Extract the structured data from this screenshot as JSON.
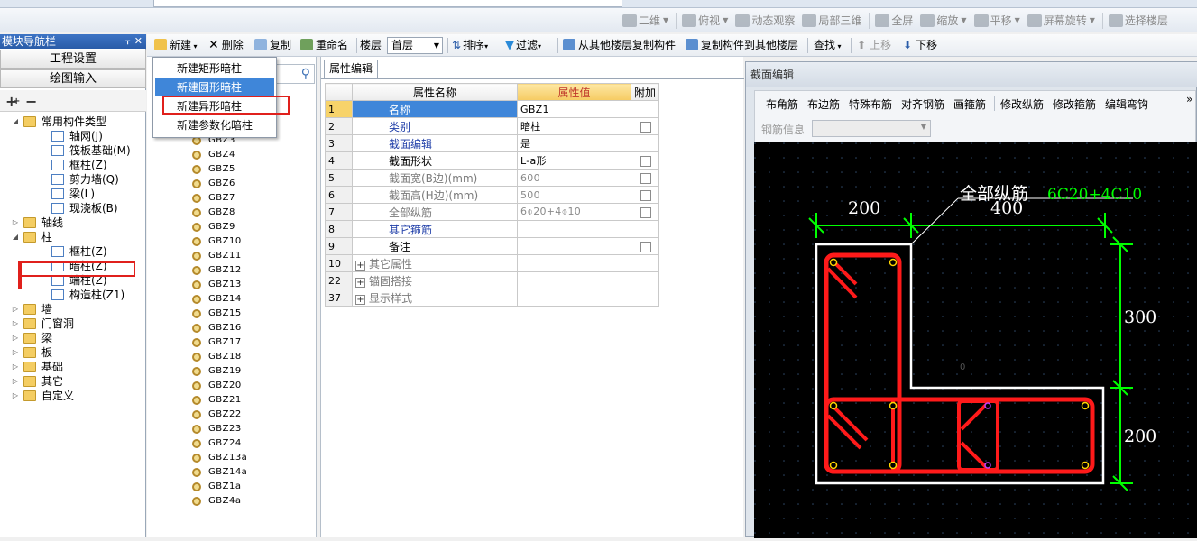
{
  "view_toolbar": {
    "items": [
      {
        "label": "二维",
        "caret": true
      },
      {
        "label": "俯视",
        "caret": true
      },
      {
        "label": "动态观察",
        "caret": false
      },
      {
        "label": "局部三维",
        "caret": false
      },
      {
        "label": "全屏",
        "caret": false
      },
      {
        "label": "缩放",
        "caret": true
      },
      {
        "label": "平移",
        "caret": true
      },
      {
        "label": "屏幕旋转",
        "caret": true
      },
      {
        "label": "选择楼层",
        "caret": false
      }
    ]
  },
  "nav": {
    "title": "模块导航栏",
    "pin": "ᚁ",
    "close": "✕",
    "project_settings": "工程设置",
    "drawing_input": "绘图输入",
    "tree": [
      {
        "level": 0,
        "expand": "◢",
        "label": "常用构件类型",
        "icon": "folder"
      },
      {
        "level": 1,
        "label": "轴网(J)",
        "icon": "comp"
      },
      {
        "level": 1,
        "label": "筏板基础(M)",
        "icon": "comp"
      },
      {
        "level": 1,
        "label": "框柱(Z)",
        "icon": "comp"
      },
      {
        "level": 1,
        "label": "剪力墙(Q)",
        "icon": "comp"
      },
      {
        "level": 1,
        "label": "梁(L)",
        "icon": "comp"
      },
      {
        "level": 1,
        "label": "现浇板(B)",
        "icon": "comp"
      },
      {
        "level": 0,
        "expand": "▷",
        "label": "轴线",
        "icon": "folder"
      },
      {
        "level": 0,
        "expand": "◢",
        "label": "柱",
        "icon": "folder"
      },
      {
        "level": 1,
        "label": "框柱(Z)",
        "icon": "comp"
      },
      {
        "level": 1,
        "label": "暗柱(Z)",
        "icon": "comp"
      },
      {
        "level": 1,
        "label": "端柱(Z)",
        "icon": "comp"
      },
      {
        "level": 1,
        "label": "构造柱(Z1)",
        "icon": "comp"
      },
      {
        "level": 0,
        "expand": "▷",
        "label": "墙",
        "icon": "folder"
      },
      {
        "level": 0,
        "expand": "▷",
        "label": "门窗洞",
        "icon": "folder"
      },
      {
        "level": 0,
        "expand": "▷",
        "label": "梁",
        "icon": "folder"
      },
      {
        "level": 0,
        "expand": "▷",
        "label": "板",
        "icon": "folder"
      },
      {
        "level": 0,
        "expand": "▷",
        "label": "基础",
        "icon": "folder"
      },
      {
        "level": 0,
        "expand": "▷",
        "label": "其它",
        "icon": "folder"
      },
      {
        "level": 0,
        "expand": "▷",
        "label": "自定义",
        "icon": "folder"
      }
    ]
  },
  "main_toolbar": {
    "new": "新建",
    "delete": "删除",
    "copy": "复制",
    "rename": "重命名",
    "floor_label": "楼层",
    "floor_value": "首层",
    "sort": "排序",
    "filter": "过滤",
    "copy_from_floor": "从其他楼层复制构件",
    "copy_to_floor": "复制构件到其他楼层",
    "find": "查找",
    "move_up": "上移",
    "move_down": "下移"
  },
  "new_menu": [
    {
      "label": "新建矩形暗柱",
      "active": false
    },
    {
      "label": "新建圆形暗柱",
      "active": true
    },
    {
      "label": "新建异形暗柱",
      "active": false
    },
    {
      "label": "新建参数化暗柱",
      "active": false
    }
  ],
  "component_list": [
    "GBZ3",
    "GBZ4",
    "GBZ5",
    "GBZ6",
    "GBZ7",
    "GBZ8",
    "GBZ9",
    "GBZ10",
    "GBZ11",
    "GBZ12",
    "GBZ13",
    "GBZ14",
    "GBZ15",
    "GBZ16",
    "GBZ17",
    "GBZ18",
    "GBZ19",
    "GBZ20",
    "GBZ21",
    "GBZ22",
    "GBZ23",
    "GBZ24",
    "GBZ13a",
    "GBZ14a",
    "GBZ1a",
    "GBZ4a"
  ],
  "properties": {
    "tab": "属性编辑",
    "headers": {
      "name": "属性名称",
      "value": "属性值",
      "extra": "附加"
    },
    "rows": [
      {
        "num": "1",
        "name": "名称",
        "value": "GBZ1",
        "style": "sel",
        "check": false
      },
      {
        "num": "2",
        "name": "类别",
        "value": "暗柱",
        "style": "blue",
        "check": true
      },
      {
        "num": "3",
        "name": "截面编辑",
        "value": "是",
        "style": "blue",
        "check": false
      },
      {
        "num": "4",
        "name": "截面形状",
        "value": "L-a形",
        "style": "normal",
        "check": true
      },
      {
        "num": "5",
        "name": "截面宽(B边)(mm)",
        "value": "600",
        "style": "gray",
        "check": true
      },
      {
        "num": "6",
        "name": "截面高(H边)(mm)",
        "value": "500",
        "style": "gray",
        "check": true
      },
      {
        "num": "7",
        "name": "全部纵筋",
        "value": "6⌽20+4⌽10",
        "style": "gray",
        "check": true
      },
      {
        "num": "8",
        "name": "其它箍筋",
        "value": "",
        "style": "blue",
        "check": false
      },
      {
        "num": "9",
        "name": "备注",
        "value": "",
        "style": "normal",
        "check": true
      },
      {
        "num": "10",
        "name": "其它属性",
        "value": "",
        "style": "group",
        "check": false
      },
      {
        "num": "22",
        "name": "锚固搭接",
        "value": "",
        "style": "group",
        "check": false
      },
      {
        "num": "37",
        "name": "显示样式",
        "value": "",
        "style": "group",
        "check": false
      }
    ]
  },
  "section_editor": {
    "title": "截面编辑",
    "buttons": [
      "布角筋",
      "布边筋",
      "特殊布筋",
      "对齐钢筋",
      "画箍筋",
      "修改纵筋",
      "修改箍筋",
      "编辑弯钩"
    ],
    "more": "»",
    "rebar_info_label": "钢筋信息",
    "dim_top_left": "200",
    "dim_top_right": "400",
    "dim_right_top": "300",
    "dim_right_bottom": "200",
    "rebar_label": "全部纵筋",
    "rebar_value": "6C20+4C10",
    "origin_mark": "0",
    "colors": {
      "outline": "#ffffff",
      "stirrup": "#ff1a1a",
      "dimension": "#00ff00",
      "bar": "#ffd400",
      "background": "#000000"
    }
  },
  "icons": [
    "pin-icon",
    "close-icon",
    "expand-all-icon",
    "collapse-all-icon",
    "folder-icon",
    "component-icon",
    "search-icon",
    "new-icon",
    "delete-icon",
    "copy-icon",
    "rename-icon",
    "sort-icon",
    "filter-icon",
    "copy-from-floor-icon",
    "copy-to-floor-icon",
    "up-arrow-icon",
    "down-arrow-icon",
    "gear-icon"
  ]
}
